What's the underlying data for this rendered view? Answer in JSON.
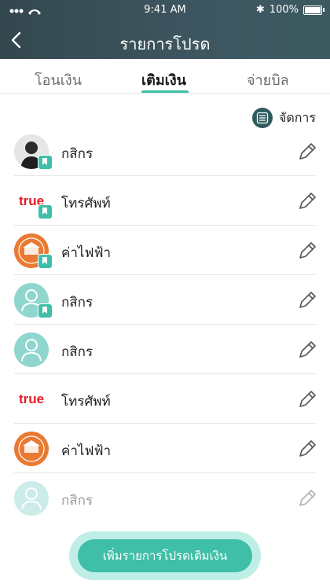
{
  "status_bar": {
    "time": "9:41 AM",
    "battery": "100%"
  },
  "header": {
    "title": "รายการโปรด"
  },
  "tabs": [
    {
      "label": "โอนเงิน",
      "active": false
    },
    {
      "label": "เติมเงิน",
      "active": true
    },
    {
      "label": "จ่ายบิล",
      "active": false
    }
  ],
  "manage_label": "จัดการ",
  "favorites": [
    {
      "label": "กสิกร",
      "avatar": "photo-avatar",
      "bookmarked": true
    },
    {
      "label": "โทรศัพท์",
      "avatar": "true-logo",
      "bookmarked": true
    },
    {
      "label": "ค่าไฟฟ้า",
      "avatar": "mea-logo",
      "bookmarked": true
    },
    {
      "label": "กสิกร",
      "avatar": "person-icon",
      "bookmarked": true
    },
    {
      "label": "กสิกร",
      "avatar": "person-icon",
      "bookmarked": false
    },
    {
      "label": "โทรศัพท์",
      "avatar": "true-logo",
      "bookmarked": false
    },
    {
      "label": "ค่าไฟฟ้า",
      "avatar": "mea-logo",
      "bookmarked": false
    },
    {
      "label": "กสิกร",
      "avatar": "person-icon",
      "bookmarked": false
    }
  ],
  "true_logo_text": "true",
  "add_button_label": "เพิ่มรายการโปรดเติมเงิน",
  "colors": {
    "header": "#3a4f58",
    "accent": "#3fbfa7",
    "tab_indicator": "#3fbfa7"
  }
}
